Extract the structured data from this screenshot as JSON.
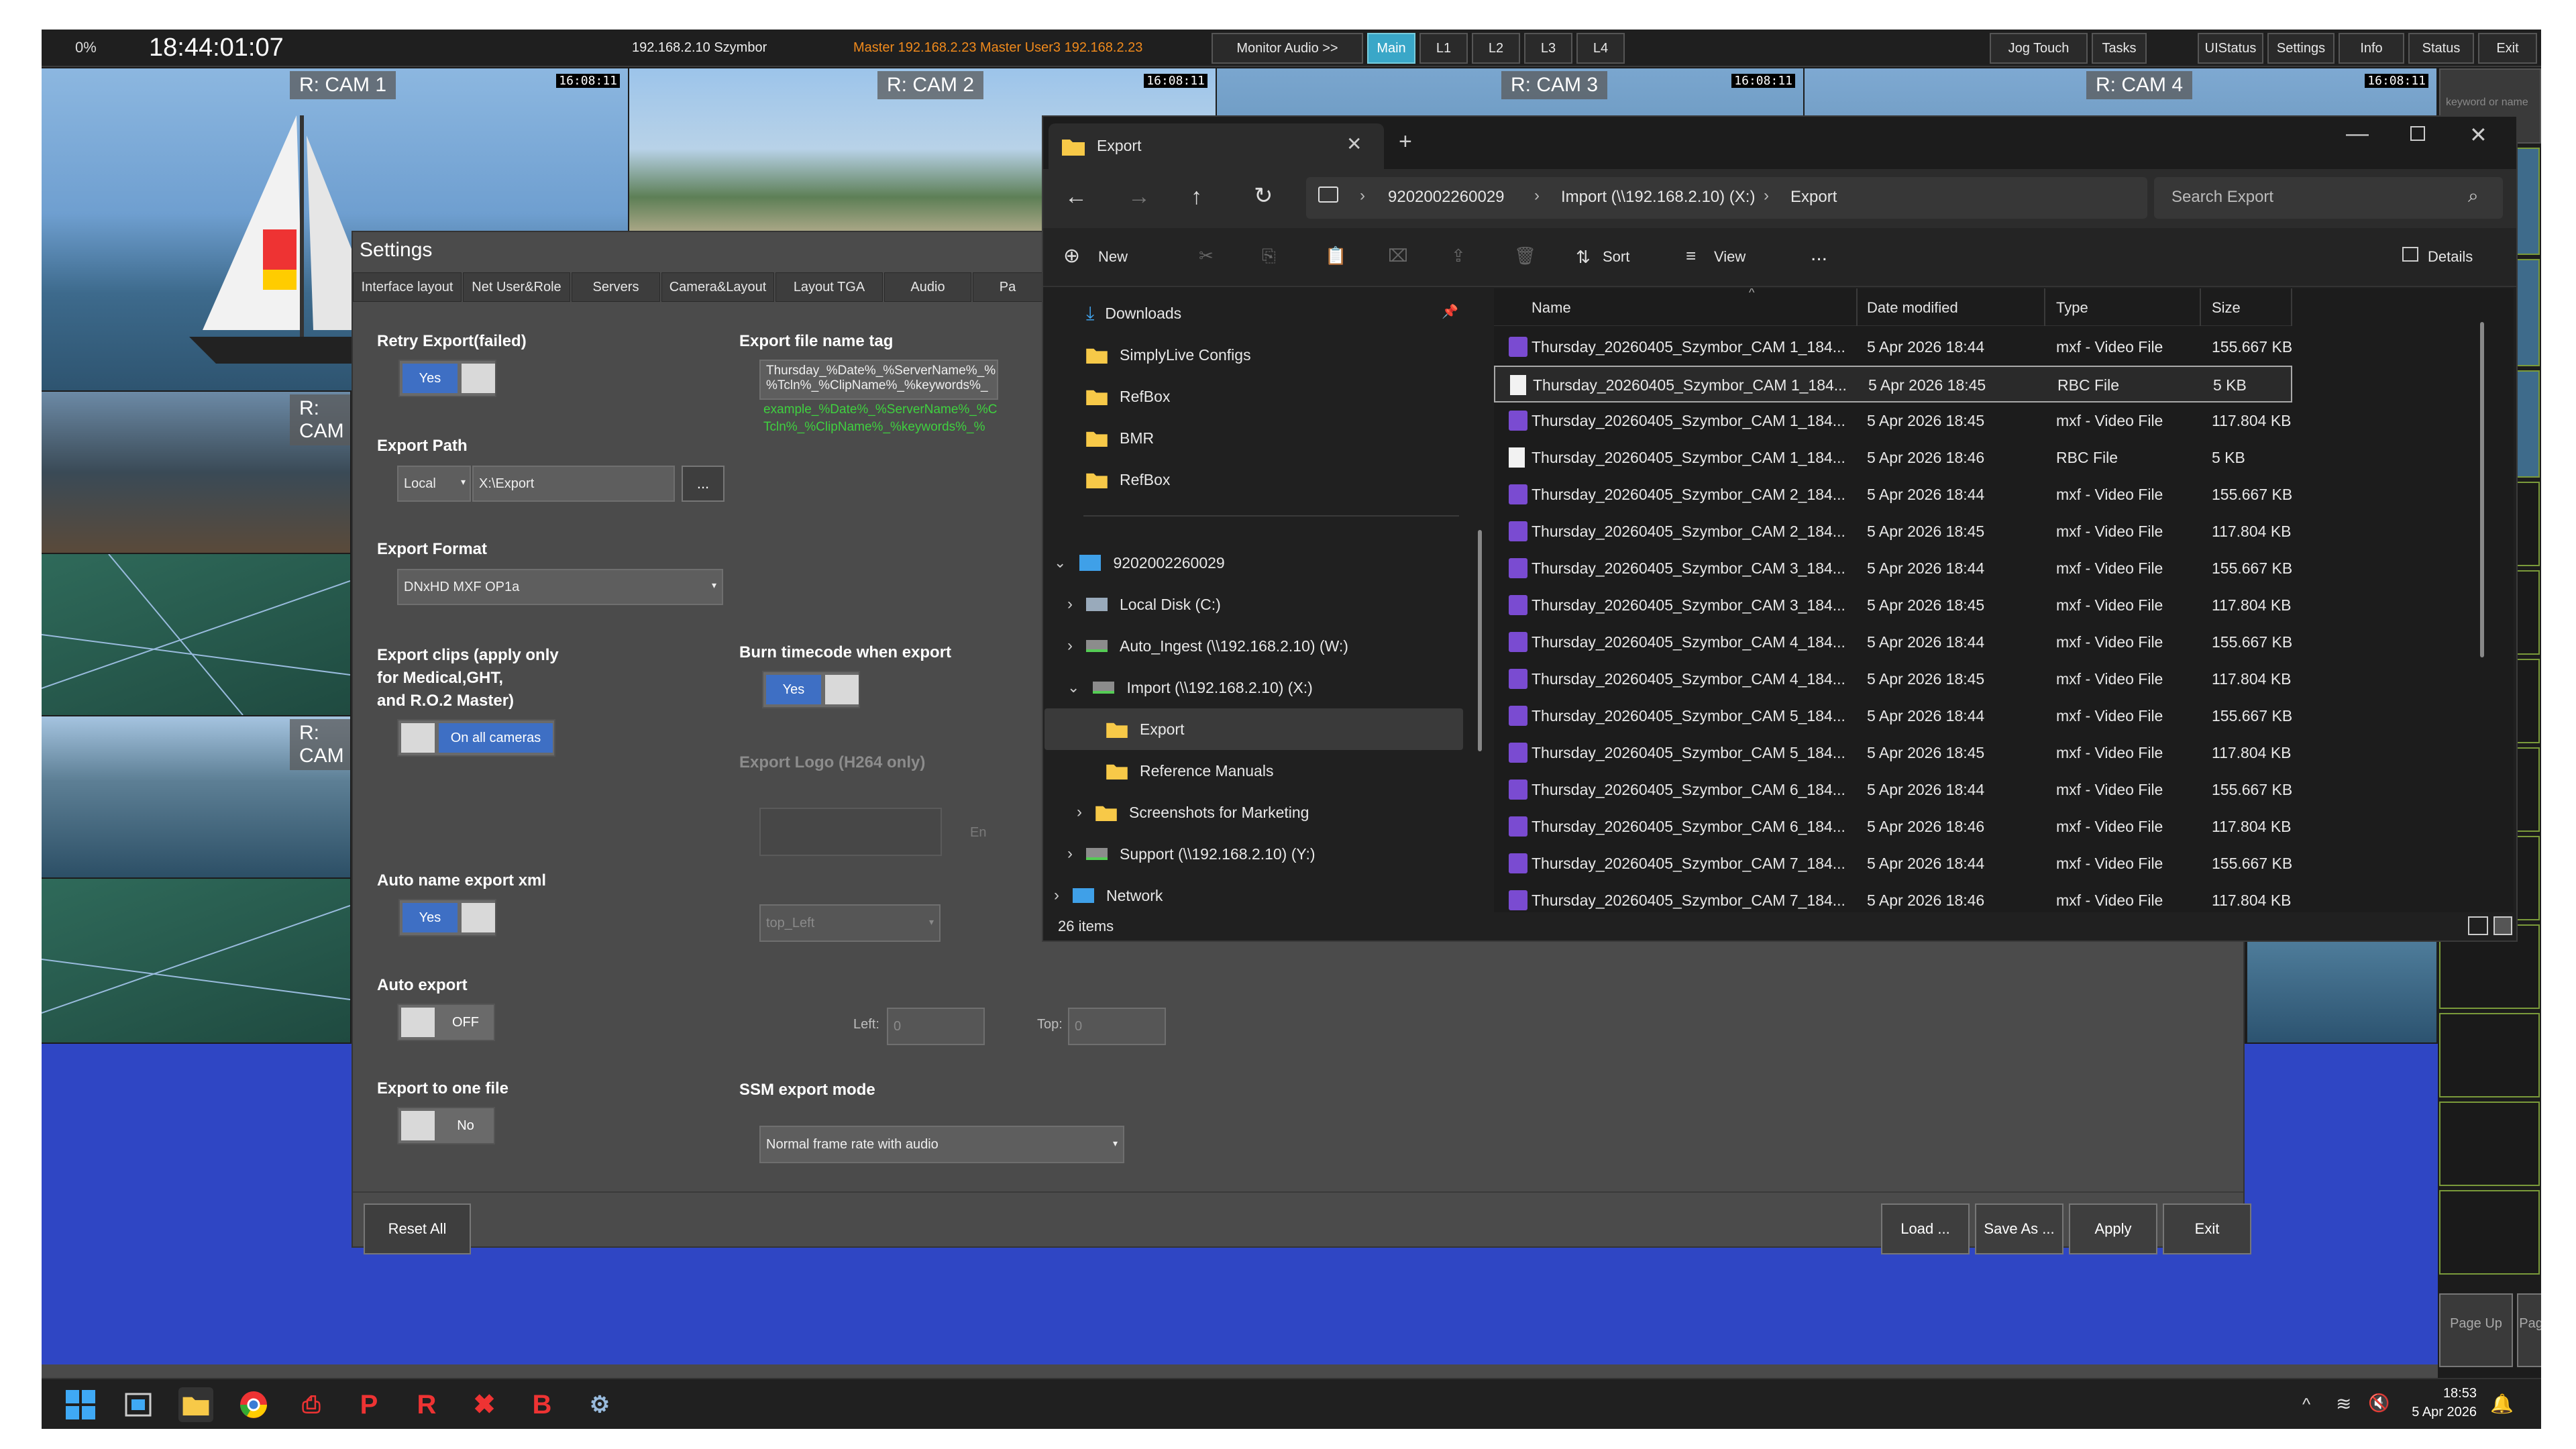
{
  "topbar": {
    "percent": "0%",
    "clock": "18:44:01:07",
    "ip_info": "192.168.2.10 Szymbor",
    "master_info": "Master 192.168.2.23  Master  User3  192.168.2.23",
    "monitor_audio": "Monitor Audio >>",
    "main": "Main",
    "l1": "L1",
    "l2": "L2",
    "l3": "L3",
    "l4": "L4",
    "jog_touch": "Jog Touch",
    "tasks": "Tasks",
    "uistatus": "UIStatus",
    "settings": "Settings",
    "info": "Info",
    "status": "Status",
    "exit": "Exit"
  },
  "cams": {
    "cam1": "R: CAM 1",
    "cam2": "R: CAM 2",
    "cam3": "R: CAM 3",
    "cam4": "R: CAM 4",
    "cam_partial": "R: CAM",
    "timecode": "16:08:11"
  },
  "settings": {
    "title": "Settings",
    "tabs": [
      "Interface layout",
      "Net User&Role",
      "Servers",
      "Camera&Layout",
      "Layout TGA",
      "Audio",
      "Pa"
    ],
    "retry_export_label": "Retry Export(failed)",
    "retry_export_value": "Yes",
    "export_path_label": "Export Path",
    "export_path_mode": "Local",
    "export_path_value": "X:\\Export",
    "export_path_browse": "...",
    "export_format_label": "Export Format",
    "export_format_value": "DNxHD MXF OP1a",
    "export_clips_label_1": "Export clips (apply only",
    "export_clips_label_2": "for Medical,GHT,",
    "export_clips_label_3": "and R.O.2 Master)",
    "export_clips_value": "On all cameras",
    "auto_name_label": "Auto name export xml",
    "auto_name_value": "Yes",
    "auto_export_label": "Auto export",
    "auto_export_value": "OFF",
    "one_file_label": "Export to one file",
    "one_file_value": "No",
    "file_name_tag_label": "Export file name tag",
    "file_name_tag_line1": "Thursday_%Date%_%ServerName%_%",
    "file_name_tag_line2": "%Tcln%_%ClipName%_%keywords%_",
    "example_line1": "example_%Date%_%ServerName%_%C",
    "example_line2": "Tcln%_%ClipName%_%keywords%_%",
    "burn_tc_label": "Burn timecode when export",
    "burn_tc_value": "Yes",
    "export_logo_label": "Export Logo (H264 only)",
    "export_logo_hint": "En",
    "logo_position": "top_Left",
    "left_label": "Left:",
    "left_value": "0",
    "top_label": "Top:",
    "top_value": "0",
    "ssm_label": "SSM export mode",
    "ssm_value": "Normal frame rate with audio",
    "reset_all": "Reset All",
    "load": "Load ...",
    "save_as": "Save As ...",
    "apply": "Apply",
    "exit": "Exit"
  },
  "explorer": {
    "tab_title": "Export",
    "breadcrumb": [
      "9202002260029",
      "Import (\\\\192.168.2.10) (X:)",
      "Export"
    ],
    "search_placeholder": "Search Export",
    "toolbar": {
      "new": "New",
      "sort": "Sort",
      "view": "View",
      "more": "...",
      "details": "Details"
    },
    "nav": {
      "quick": [
        "Downloads",
        "SimplyLive Configs",
        "RefBox",
        "BMR",
        "RefBox"
      ],
      "computer": "9202002260029",
      "drives": [
        {
          "label": "Local Disk (C:)"
        },
        {
          "label": "Auto_Ingest (\\\\192.168.2.10) (W:)"
        },
        {
          "label": "Import (\\\\192.168.2.10) (X:)"
        }
      ],
      "folders": [
        "Export",
        "Reference Manuals",
        "Screenshots for Marketing"
      ],
      "support": "Support (\\\\192.168.2.10) (Y:)",
      "network": "Network"
    },
    "columns": [
      "Name",
      "Date modified",
      "Type",
      "Size"
    ],
    "files": [
      {
        "name": "Thursday_20260405_Szymbor_CAM 1_184...",
        "date": "5 Apr 2026 18:44",
        "type": "mxf - Video File",
        "size": "155.667 KB",
        "kind": "video"
      },
      {
        "name": "Thursday_20260405_Szymbor_CAM 1_184...",
        "date": "5 Apr 2026 18:45",
        "type": "RBC File",
        "size": "5 KB",
        "kind": "doc"
      },
      {
        "name": "Thursday_20260405_Szymbor_CAM 1_184...",
        "date": "5 Apr 2026 18:45",
        "type": "mxf - Video File",
        "size": "117.804 KB",
        "kind": "video"
      },
      {
        "name": "Thursday_20260405_Szymbor_CAM 1_184...",
        "date": "5 Apr 2026 18:46",
        "type": "RBC File",
        "size": "5 KB",
        "kind": "doc"
      },
      {
        "name": "Thursday_20260405_Szymbor_CAM 2_184...",
        "date": "5 Apr 2026 18:44",
        "type": "mxf - Video File",
        "size": "155.667 KB",
        "kind": "video"
      },
      {
        "name": "Thursday_20260405_Szymbor_CAM 2_184...",
        "date": "5 Apr 2026 18:45",
        "type": "mxf - Video File",
        "size": "117.804 KB",
        "kind": "video"
      },
      {
        "name": "Thursday_20260405_Szymbor_CAM 3_184...",
        "date": "5 Apr 2026 18:44",
        "type": "mxf - Video File",
        "size": "155.667 KB",
        "kind": "video"
      },
      {
        "name": "Thursday_20260405_Szymbor_CAM 3_184...",
        "date": "5 Apr 2026 18:45",
        "type": "mxf - Video File",
        "size": "117.804 KB",
        "kind": "video"
      },
      {
        "name": "Thursday_20260405_Szymbor_CAM 4_184...",
        "date": "5 Apr 2026 18:44",
        "type": "mxf - Video File",
        "size": "155.667 KB",
        "kind": "video"
      },
      {
        "name": "Thursday_20260405_Szymbor_CAM 4_184...",
        "date": "5 Apr 2026 18:45",
        "type": "mxf - Video File",
        "size": "117.804 KB",
        "kind": "video"
      },
      {
        "name": "Thursday_20260405_Szymbor_CAM 5_184...",
        "date": "5 Apr 2026 18:44",
        "type": "mxf - Video File",
        "size": "155.667 KB",
        "kind": "video"
      },
      {
        "name": "Thursday_20260405_Szymbor_CAM 5_184...",
        "date": "5 Apr 2026 18:45",
        "type": "mxf - Video File",
        "size": "117.804 KB",
        "kind": "video"
      },
      {
        "name": "Thursday_20260405_Szymbor_CAM 6_184...",
        "date": "5 Apr 2026 18:44",
        "type": "mxf - Video File",
        "size": "155.667 KB",
        "kind": "video"
      },
      {
        "name": "Thursday_20260405_Szymbor_CAM 6_184...",
        "date": "5 Apr 2026 18:46",
        "type": "mxf - Video File",
        "size": "117.804 KB",
        "kind": "video"
      },
      {
        "name": "Thursday_20260405_Szymbor_CAM 7_184...",
        "date": "5 Apr 2026 18:44",
        "type": "mxf - Video File",
        "size": "155.667 KB",
        "kind": "video"
      },
      {
        "name": "Thursday_20260405_Szymbor_CAM 7_184...",
        "date": "5 Apr 2026 18:46",
        "type": "mxf - Video File",
        "size": "117.804 KB",
        "kind": "video"
      }
    ],
    "status": "26 items"
  },
  "right_panel": {
    "search_placeholder": "keyword or name",
    "page_up": "Page Up",
    "page_down": "Page Down"
  },
  "taskbar": {
    "time": "18:53",
    "date": "5 Apr 2026"
  }
}
